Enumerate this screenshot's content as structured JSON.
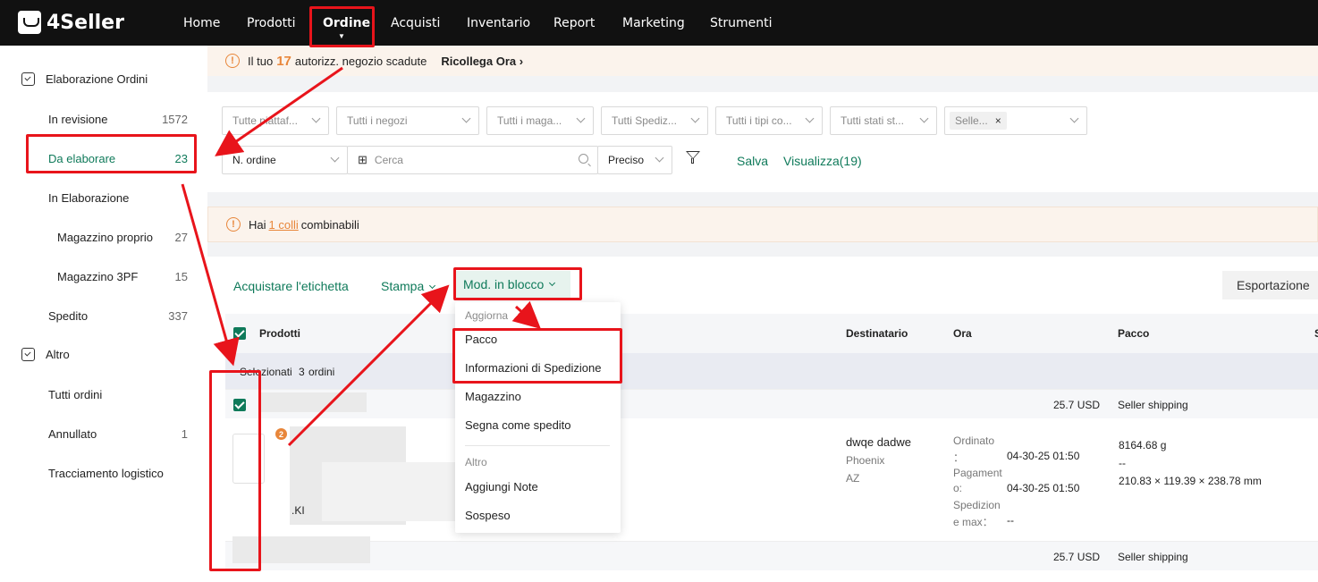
{
  "app": {
    "logo_text": "4Seller"
  },
  "nav": {
    "items": [
      "Home",
      "Prodotti",
      "Ordine",
      "Acquisti",
      "Inventario",
      "Report",
      "Marketing",
      "Strumenti"
    ],
    "active": "Ordine",
    "caret_glyph": "▼"
  },
  "alert_auth": {
    "prefix": "Il tuo",
    "count": "17",
    "suffix": "autorizz. negozio scadute",
    "link": "Ricollega Ora",
    "link_chevron": "›",
    "icon_glyph": "!"
  },
  "sidebar": {
    "group1": "Elaborazione Ordini",
    "items": [
      {
        "label": "In revisione",
        "count": "1572"
      },
      {
        "label": "Da elaborare",
        "count": "23"
      },
      {
        "label": "In Elaborazione",
        "count": ""
      },
      {
        "label": "Magazzino proprio",
        "count": "27"
      },
      {
        "label": "Magazzino 3PF",
        "count": "15"
      },
      {
        "label": "Spedito",
        "count": "337"
      }
    ],
    "group2": "Altro",
    "items2": [
      {
        "label": "Tutti ordini",
        "count": ""
      },
      {
        "label": "Annullato",
        "count": "1"
      },
      {
        "label": "Tracciamento logistico",
        "count": ""
      }
    ]
  },
  "filters": {
    "selects": [
      "Tutte piattaf...",
      "Tutti i negozi",
      "Tutti i maga...",
      "Tutti Spediz...",
      "Tutti i tipi co...",
      "Tutti stati st..."
    ],
    "tag": "Selle...",
    "tag_close": "×",
    "order_field": "N. ordine",
    "grid_glyph": "⊞",
    "search_placeholder": "Cerca",
    "match_mode": "Preciso",
    "save": "Salva",
    "view": "Visualizza(19)"
  },
  "alert_combine": {
    "prefix": "Hai",
    "link": "1 colli",
    "suffix": "combinabili",
    "icon_glyph": "!"
  },
  "toolbar": {
    "buy_label": "Acquistare l'etichetta",
    "print": "Stampa",
    "bulk": "Mod. in blocco",
    "export": "Esportazione"
  },
  "table": {
    "headers": {
      "products": "Prodotti",
      "recipient": "Destinatario",
      "time": "Ora",
      "package": "Pacco",
      "extra": "S"
    },
    "selected_prefix": "Selezionati",
    "selected_count": "3",
    "selected_suffix": "ordini",
    "group_rows": [
      {
        "amount": "25.7 USD",
        "shipping": "Seller shipping"
      },
      {
        "amount": "25.7 USD",
        "shipping": "Seller shipping"
      }
    ],
    "order": {
      "badge": "2",
      "sku_fragment": ".KI",
      "recipient_name": "dwqe dadwe",
      "city": "Phoenix",
      "state": "AZ",
      "ordered_label": "Ordinato",
      "ordered_colon": "：",
      "ordered_value": "04-30-25 01:50",
      "payment_label_1": "Pagament",
      "payment_label_2": "o:",
      "payment_value": "04-30-25 01:50",
      "ship_label_1": "Spedizion",
      "ship_label_2": "e max：",
      "ship_value": "--",
      "weight": "8164.68 g",
      "dash": "--",
      "dims": "210.83 × 119.39 × 238.78 mm"
    }
  },
  "bulk_menu": {
    "section1": "Aggiorna",
    "items1": [
      "Pacco",
      "Informazioni di Spedizione",
      "Magazzino",
      "Segna come spedito"
    ],
    "section2": "Altro",
    "items2": [
      "Aggiungi Note",
      "Sospeso"
    ]
  },
  "colors": {
    "accent": "#0f7a5a",
    "warning": "#e8863a",
    "annotation": "#e8141b",
    "topbar": "#111111"
  }
}
